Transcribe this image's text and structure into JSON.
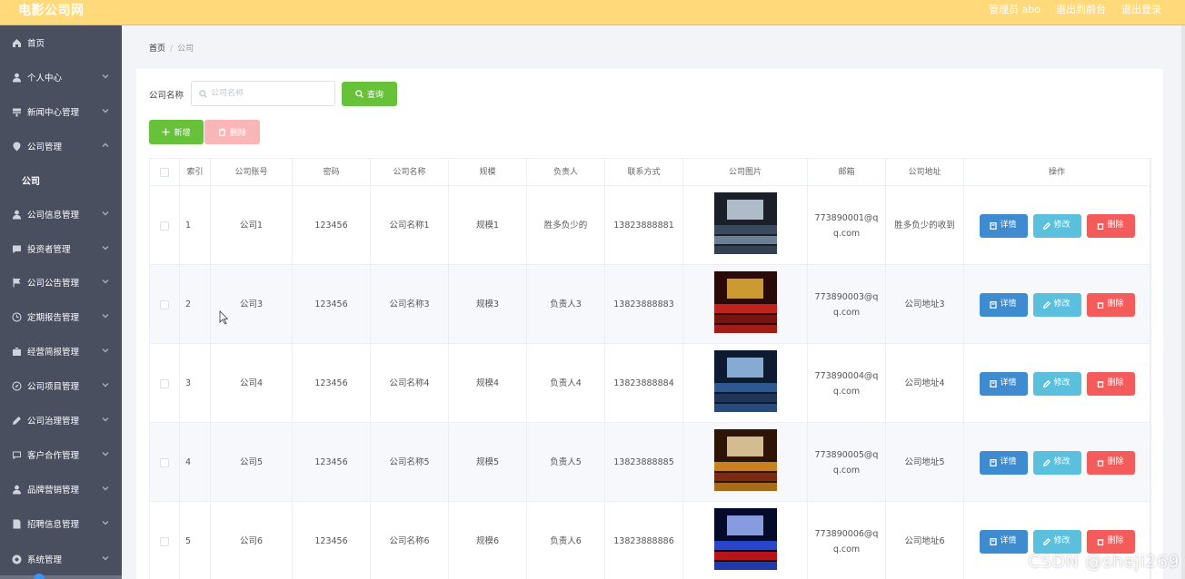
{
  "header": {
    "brand": "电影公司网",
    "admin_label": "管理员 abo",
    "goto_front": "退出到前台",
    "logout": "退出登录"
  },
  "sidebar": {
    "items": [
      {
        "label": "首页",
        "icon": "home-icon"
      },
      {
        "label": "个人中心",
        "icon": "user-icon"
      },
      {
        "label": "新闻中心管理",
        "icon": "news-icon"
      },
      {
        "label": "公司管理",
        "icon": "location-icon"
      },
      {
        "label": "公司信息管理",
        "icon": "user-icon"
      },
      {
        "label": "投资者管理",
        "icon": "chat-icon"
      },
      {
        "label": "公司公告管理",
        "icon": "flag-icon"
      },
      {
        "label": "定期报告管理",
        "icon": "clock-icon"
      },
      {
        "label": "经营简报管理",
        "icon": "briefcase-icon"
      },
      {
        "label": "公司项目管理",
        "icon": "compass-icon"
      },
      {
        "label": "公司治理管理",
        "icon": "edit-icon"
      },
      {
        "label": "客户合作管理",
        "icon": "message-icon"
      },
      {
        "label": "品牌营销管理",
        "icon": "user-icon"
      },
      {
        "label": "招聘信息管理",
        "icon": "doc-icon"
      },
      {
        "label": "系统管理",
        "icon": "settings-icon"
      }
    ],
    "sub_active": "公司"
  },
  "breadcrumb": {
    "home": "首页",
    "separator": "/",
    "current": "公司"
  },
  "search": {
    "label": "公司名称",
    "placeholder": "公司名称",
    "value": "",
    "query_button": "查询"
  },
  "toolbar": {
    "add_button": "新增",
    "delete_button": "删除"
  },
  "table": {
    "columns": [
      "",
      "索引",
      "公司账号",
      "密码",
      "公司名称",
      "规模",
      "负责人",
      "联系方式",
      "公司图片",
      "邮箱",
      "公司地址",
      "操作"
    ],
    "rows": [
      {
        "index": "1",
        "account": "公司1",
        "password": "123456",
        "name": "公司名称1",
        "scale": "规模1",
        "manager": "胜多负少的",
        "phone": "13823888881",
        "email": "773890001@qq.com",
        "address": "胜多负少的收到"
      },
      {
        "index": "2",
        "account": "公司3",
        "password": "123456",
        "name": "公司名称3",
        "scale": "规模3",
        "manager": "负责人3",
        "phone": "13823888883",
        "email": "773890003@qq.com",
        "address": "公司地址3"
      },
      {
        "index": "3",
        "account": "公司4",
        "password": "123456",
        "name": "公司名称4",
        "scale": "规模4",
        "manager": "负责人4",
        "phone": "13823888884",
        "email": "773890004@qq.com",
        "address": "公司地址4"
      },
      {
        "index": "4",
        "account": "公司5",
        "password": "123456",
        "name": "公司名称5",
        "scale": "规模5",
        "manager": "负责人5",
        "phone": "13823888885",
        "email": "773890005@qq.com",
        "address": "公司地址5"
      },
      {
        "index": "5",
        "account": "公司6",
        "password": "123456",
        "name": "公司名称6",
        "scale": "规模6",
        "manager": "负责人6",
        "phone": "13823888886",
        "email": "773890006@qq.com",
        "address": "公司地址6"
      }
    ],
    "actions": {
      "detail": "详情",
      "edit": "修改",
      "remove": "删除"
    }
  },
  "watermark": "CSDN @sheji269"
}
